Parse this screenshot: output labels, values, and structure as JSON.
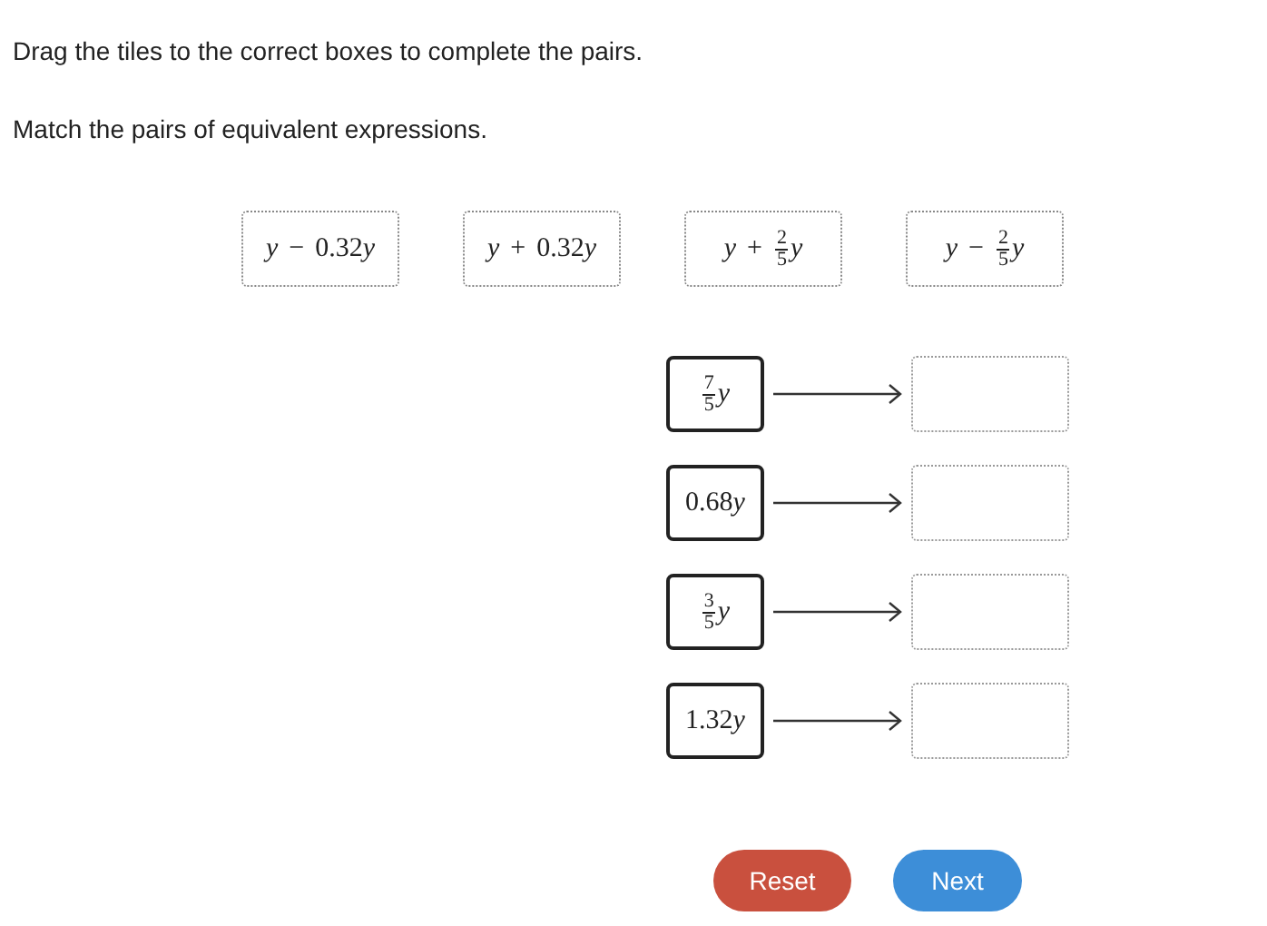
{
  "instructions": [
    "Drag the tiles to the correct boxes to complete the pairs.",
    "Match the pairs of equivalent expressions."
  ],
  "tiles": [
    [
      {
        "kind": "var",
        "text": "y"
      },
      {
        "kind": "op",
        "text": "−"
      },
      {
        "kind": "num",
        "text": "0.32"
      },
      {
        "kind": "var",
        "text": "y"
      }
    ],
    [
      {
        "kind": "var",
        "text": "y"
      },
      {
        "kind": "op",
        "text": "+"
      },
      {
        "kind": "num",
        "text": "0.32"
      },
      {
        "kind": "var",
        "text": "y"
      }
    ],
    [
      {
        "kind": "var",
        "text": "y"
      },
      {
        "kind": "op",
        "text": "+"
      },
      {
        "kind": "frac",
        "num": "2",
        "den": "5"
      },
      {
        "kind": "var",
        "text": "y"
      }
    ],
    [
      {
        "kind": "var",
        "text": "y"
      },
      {
        "kind": "op",
        "text": "−"
      },
      {
        "kind": "frac",
        "num": "2",
        "den": "5"
      },
      {
        "kind": "var",
        "text": "y"
      }
    ]
  ],
  "pairs": [
    {
      "prompt": [
        {
          "kind": "frac",
          "num": "7",
          "den": "5"
        },
        {
          "kind": "var",
          "text": "y"
        }
      ]
    },
    {
      "prompt": [
        {
          "kind": "num",
          "text": "0.68"
        },
        {
          "kind": "var",
          "text": "y"
        }
      ]
    },
    {
      "prompt": [
        {
          "kind": "frac",
          "num": "3",
          "den": "5"
        },
        {
          "kind": "var",
          "text": "y"
        }
      ]
    },
    {
      "prompt": [
        {
          "kind": "num",
          "text": "1.32"
        },
        {
          "kind": "var",
          "text": "y"
        }
      ]
    }
  ],
  "buttons": [
    {
      "kind": "reset",
      "label": "Reset"
    },
    {
      "kind": "next",
      "label": "Next"
    }
  ]
}
